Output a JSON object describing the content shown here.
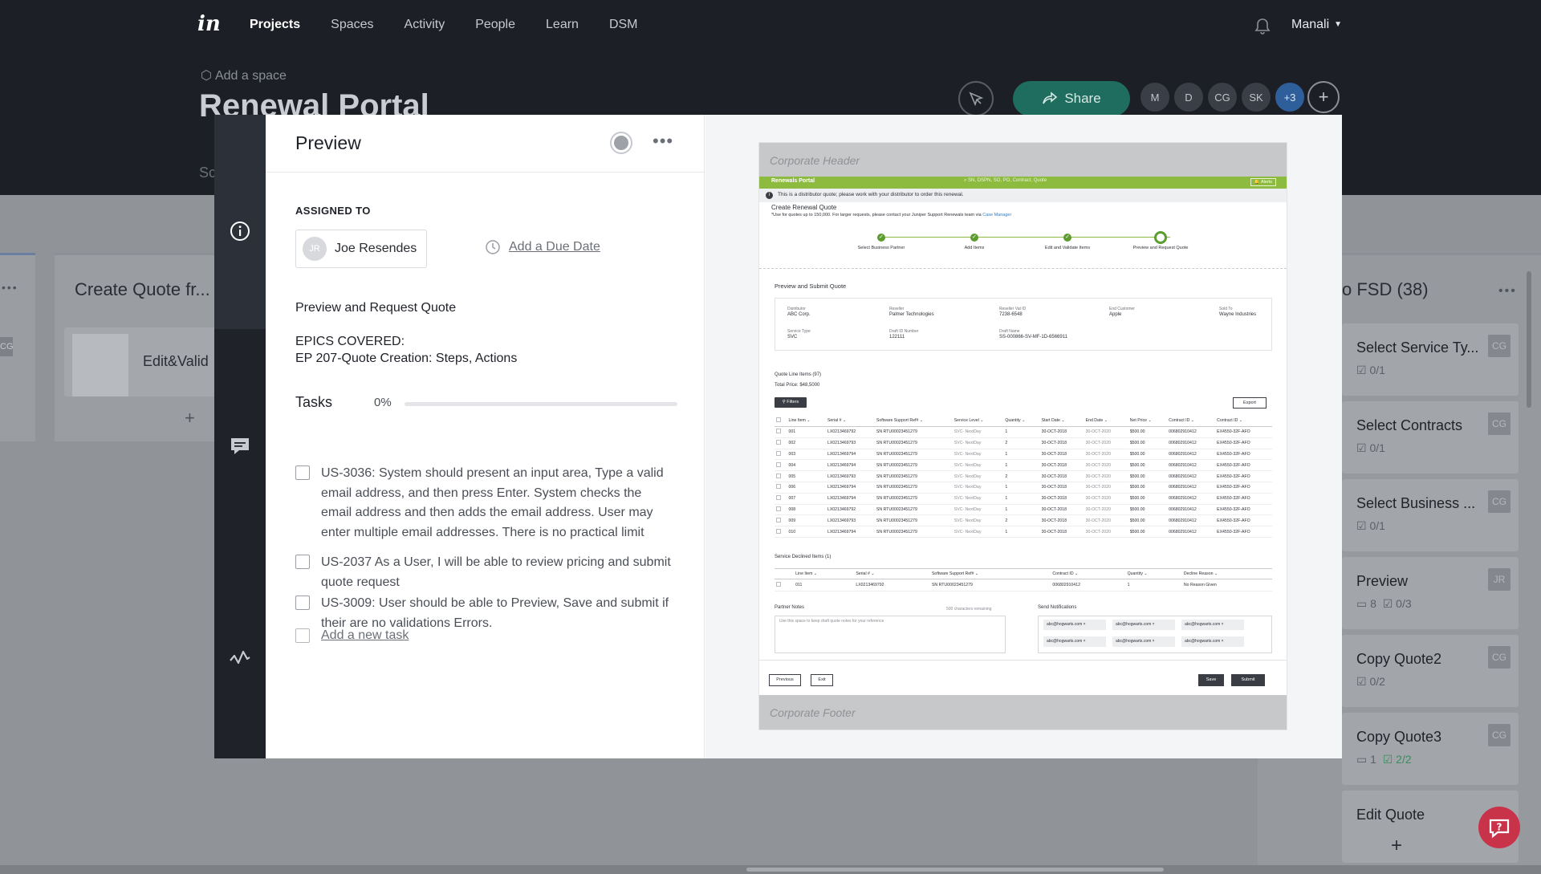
{
  "topbar": {
    "logo": "in",
    "nav": [
      "Projects",
      "Spaces",
      "Activity",
      "People",
      "Learn",
      "DSM"
    ],
    "user_name": "Manali",
    "add_to_space": "Add a space",
    "project_title": "Renewal Portal",
    "sub_tab": "Sc",
    "share_label": "Share",
    "collaborators": [
      "M",
      "D",
      "CG",
      "SK",
      "+3"
    ]
  },
  "board": {
    "left_column_title": "Create Quote fr...",
    "left_card_label": "Edit&Valid",
    "left_badge": "CG",
    "right_column_title": "o FSD",
    "right_column_count": "(38)",
    "right_cards": [
      {
        "title": "Select Service Ty...",
        "comments": "",
        "tasks": "0/1",
        "badge": "CG",
        "done": false
      },
      {
        "title": "Select Contracts",
        "comments": "",
        "tasks": "0/1",
        "badge": "CG",
        "done": false
      },
      {
        "title": "Select Business ...",
        "comments": "",
        "tasks": "0/1",
        "badge": "CG",
        "done": false
      },
      {
        "title": "Preview",
        "comments": "8",
        "tasks": "0/3",
        "badge": "JR",
        "done": false
      },
      {
        "title": "Copy Quote2",
        "comments": "",
        "tasks": "0/2",
        "badge": "CG",
        "done": false
      },
      {
        "title": "Copy Quote3",
        "comments": "1",
        "tasks": "2/2",
        "badge": "CG",
        "done": true
      },
      {
        "title": "Edit Quote",
        "comments": "",
        "tasks": "",
        "badge": "",
        "done": false
      }
    ]
  },
  "modal": {
    "title": "Preview",
    "assigned_label": "ASSIGNED TO",
    "assignee_initials": "JR",
    "assignee_name": "Joe Resendes",
    "due_date_label": "Add a Due Date",
    "description_title": "Preview and Request Quote",
    "epics": "EPICS COVERED:\nEP 207-Quote Creation: Steps, Actions",
    "tasks_label": "Tasks",
    "tasks_progress": "0%",
    "tasks_progress_value": 0,
    "tasks": [
      "US-3036: System  should present an input area, Type a valid email address, and then press Enter.  System checks the email address and then adds the email address.     User may enter multiple email addresses. There is no practical limit",
      "US-2037 As a User, I will be able to review pricing and submit quote request",
      "US-3009: User should be able to Preview, Save and submit if their are no validations Errors."
    ],
    "add_task_label": "Add a new task"
  },
  "screen": {
    "corporate_header": "Corporate Header",
    "app_name": "Renewals Portal",
    "search_placeholder": "SN, DSPN, SO, PO, Contract, Quote",
    "alerts": "Alerts",
    "info_text": "This is a distributor quote; please work with your distributor to order this renewal.",
    "create_heading": "Create Renewal Quote",
    "create_sub": "*Use for quotes up to 150,000. For larger requests, please contact your Juniper Support Renewals team via",
    "create_sub_link": "Case Manager",
    "steps": [
      "Select Business Partner",
      "Add Items",
      "Edit and Validate Items",
      "Preview and Request Quote"
    ],
    "section_title": "Preview and Submit Quote",
    "fields": [
      {
        "label": "Distributor",
        "value": "ABC Corp."
      },
      {
        "label": "Reseller",
        "value": "Palmer Technologies"
      },
      {
        "label": "Reseller Vat ID",
        "value": "7238-6548"
      },
      {
        "label": "End Customer",
        "value": "Apple"
      },
      {
        "label": "Sold To",
        "value": "Wayne Industries"
      },
      {
        "label": "Service Type",
        "value": "SVC"
      },
      {
        "label": "Draft ID Number",
        "value": "122111"
      },
      {
        "label": "Draft Name",
        "value": "SS-000866-SV-MF-1D-6566911"
      }
    ],
    "quote_line_items": "Quote Line Items (97)",
    "total_price": "Total Price: $48,5000",
    "filters": "Filters",
    "export": "Export",
    "columns": [
      "",
      "Line Item",
      "Serial #",
      "Software Support Ref#",
      "Service Level",
      "Quantity",
      "Start Date",
      "End Date",
      "Net Price",
      "Contract ID",
      "Contract ID"
    ],
    "rows": [
      [
        "001",
        "LX0213469792",
        "SN RTU00023451279",
        "SVC- NextDay",
        "1",
        "30-OCT-2018",
        "30-OCT-2020",
        "$500.00",
        "006802910412",
        "EX4550-32F-AFO"
      ],
      [
        "002",
        "LX0213469793",
        "SN RTU00023451279",
        "SVC- NextDay",
        "2",
        "30-OCT-2018",
        "30-OCT-2020",
        "$500.00",
        "006802910412",
        "EX4550-32F-AFO"
      ],
      [
        "003",
        "LX0213469794",
        "SN RTU00023451279",
        "SVC- NextDay",
        "1",
        "30-OCT-2018",
        "30-OCT-2020",
        "$500.00",
        "006802910412",
        "EX4550-32F-AFO"
      ],
      [
        "004",
        "LX0213469794",
        "SN RTU00023451279",
        "SVC- NextDay",
        "1",
        "30-OCT-2018",
        "30-OCT-2020",
        "$500.00",
        "006802910412",
        "EX4550-32F-AFO"
      ],
      [
        "005",
        "LX0213469793",
        "SN RTU00023451279",
        "SVC- NextDay",
        "2",
        "30-OCT-2018",
        "30-OCT-2020",
        "$500.00",
        "006802910412",
        "EX4550-32F-AFO"
      ],
      [
        "006",
        "LX0213469794",
        "SN RTU00023451279",
        "SVC- NextDay",
        "1",
        "30-OCT-2018",
        "30-OCT-2020",
        "$500.00",
        "006802910412",
        "EX4550-32F-AFO"
      ],
      [
        "007",
        "LX0213469794",
        "SN RTU00023451279",
        "SVC- NextDay",
        "1",
        "30-OCT-2018",
        "30-OCT-2020",
        "$500.00",
        "006802910412",
        "EX4550-32F-AFO"
      ],
      [
        "008",
        "LX0213469792",
        "SN RTU00023451279",
        "SVC- NextDay",
        "1",
        "30-OCT-2018",
        "30-OCT-2020",
        "$500.00",
        "006802910412",
        "EX4550-32F-AFO"
      ],
      [
        "009",
        "LX0213469793",
        "SN RTU00023451279",
        "SVC- NextDay",
        "2",
        "30-OCT-2018",
        "30-OCT-2020",
        "$500.00",
        "006802910412",
        "EX4550-32F-AFO"
      ],
      [
        "010",
        "LX0213469794",
        "SN RTU00023451279",
        "SVC- NextDay",
        "1",
        "30-OCT-2018",
        "30-OCT-2020",
        "$500.00",
        "006802910412",
        "EX4550-32F-AFO"
      ]
    ],
    "declined_title": "Service Declined Items (1)",
    "declined_columns": [
      "",
      "Line Item",
      "Serial #",
      "Software Support Ref#",
      "Contract ID",
      "Quantity",
      "Decline Reason"
    ],
    "declined_rows": [
      [
        "011",
        "LX0213469792",
        "SN RTU00023451279",
        "006802910412",
        "1",
        "No Reason Given"
      ]
    ],
    "partner_notes_label": "Partner Notes",
    "partner_notes_remaining": "500 characters remaining",
    "partner_notes_placeholder": "Use this space to keep draft quote notes for your reference",
    "send_notifications_label": "Send Notifications",
    "emails": [
      "abc@hogwarts.com",
      "abc@hogwarts.com",
      "abc@hogwarts.com",
      "abc@hogwarts.com",
      "abc@hogwarts.com",
      "abc@hogwarts.com"
    ],
    "buttons": {
      "previous": "Previous",
      "exit": "Exit",
      "save": "Save",
      "submit": "Submit"
    },
    "corporate_footer": "Corporate Footer"
  },
  "colors": {
    "nav_bg": "#1c1f25",
    "share_green": "#1e6d5f",
    "portal_green": "#8dbb3f",
    "help_red": "#c9334a",
    "rail_bg": "#1f2329"
  }
}
